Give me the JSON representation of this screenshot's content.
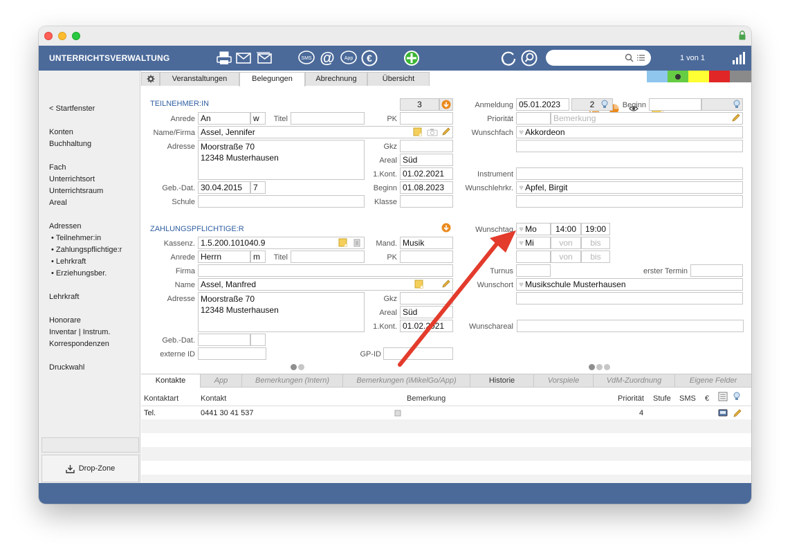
{
  "app": {
    "title": "UNTERRICHTSVERWALTUNG",
    "record_count": "1 von 1"
  },
  "search": {
    "placeholder": ""
  },
  "sidebar": {
    "back": "< Startfenster",
    "items": [
      "Konten",
      "Buchhaltung",
      "Fach",
      "Unterrichtsort",
      "Unterrichtsraum",
      "Areal",
      "Adressen"
    ],
    "adressen_sub": [
      "• Teilnehmer:in",
      "• Zahlungspflichtige:r",
      "• Lehrkraft",
      "• Erziehungsber."
    ],
    "items2": [
      "Lehrkraft",
      "Honorare",
      "Inventar | Instrum.",
      "Korrespondenzen",
      "Druckwahl"
    ],
    "dropzone": "Drop-Zone"
  },
  "tabs": [
    "Veranstaltungen",
    "Belegungen",
    "Abrechnung",
    "Übersicht"
  ],
  "active_tab": "Belegungen",
  "colors": {
    "strip": [
      "#8ec6ee",
      "#66cc44",
      "#ffff33",
      "#e02626",
      "#8a8a8a"
    ],
    "accent": "#4b6a9a",
    "orange": "#ea8a1c",
    "arrow": "#e33b2c"
  },
  "teilnehmer": {
    "section": "TEILNEHMER:IN",
    "count": "3",
    "labels": {
      "anrede": "Anrede",
      "titel": "Titel",
      "pk": "PK",
      "name": "Name/Firma",
      "adresse": "Adresse",
      "gkz": "Gkz",
      "areal": "Areal",
      "kont": "1.Kont.",
      "gebdat": "Geb.-Dat.",
      "beginn": "Beginn",
      "schule": "Schule",
      "klasse": "Klasse"
    },
    "anrede": "An",
    "anrede_code": "w",
    "titel": "",
    "pk": "",
    "name": "Assel, Jennifer",
    "adresse": "Moorstraße 70\n12348 Musterhausen",
    "gkz": "",
    "areal": "Süd",
    "kont": "01.02.2021",
    "gebdat": "30.04.2015",
    "alter": "7",
    "beginn": "01.08.2023",
    "schule": "",
    "klasse": ""
  },
  "zahler": {
    "section": "ZAHLUNGSPFLICHTIGE:R",
    "labels": {
      "kassenz": "Kassenz.",
      "mand": "Mand.",
      "anrede": "Anrede",
      "titel": "Titel",
      "pk": "PK",
      "firma": "Firma",
      "name": "Name",
      "adresse": "Adresse",
      "gkz": "Gkz",
      "areal": "Areal",
      "kont": "1.Kont.",
      "gebdat": "Geb.-Dat.",
      "externe_id": "externe ID",
      "gpid": "GP-ID"
    },
    "kassenz": "1.5.200.101040.9",
    "mand": "Musik",
    "anrede": "Herrn",
    "anrede_code": "m",
    "titel": "",
    "pk": "",
    "firma": "",
    "name": "Assel, Manfred",
    "adresse": "Moorstraße 70\n12348 Musterhausen",
    "gkz": "",
    "areal": "Süd",
    "kont": "01.02.2021",
    "gebdat": "",
    "externe_id": "",
    "gpid": ""
  },
  "anmeldung": {
    "labels": {
      "anmeldung": "Anmeldung",
      "beginn": "Beginn",
      "prioritaet": "Priorität",
      "wunschfach": "Wunschfach",
      "instrument": "Instrument",
      "wunschlehrkr": "Wunschlehrkr.",
      "wunschtag": "Wunschtag",
      "turnus": "Turnus",
      "erster_termin": "erster Termin",
      "wunschort": "Wunschort",
      "wunschareal": "Wunschareal"
    },
    "datum": "05.01.2023",
    "nummer": "2",
    "beginn": "",
    "prioritaet": "",
    "bemerkung_placeholder": "Bemerkung",
    "wunschfach": "Akkordeon",
    "wunschfach2": "",
    "instrument": "",
    "wunschlehrkr": "Apfel, Birgit",
    "wunschlehrkr2": "",
    "wunschtage": [
      {
        "tag": "Mo",
        "von": "14:00",
        "bis": "19:00"
      },
      {
        "tag": "Mi",
        "von": "von",
        "bis": "bis"
      },
      {
        "tag": "",
        "von": "von",
        "bis": "bis"
      }
    ],
    "turnus": "",
    "erster_termin": "",
    "wunschort": "Musikschule Musterhausen",
    "wunschort2": "",
    "wunschareal": ""
  },
  "bottom_tabs": [
    "Kontakte",
    "App",
    "Bemerkungen (Intern)",
    "Bemerkungen (iMikelGo/App)",
    "Historie",
    "Vorspiele",
    "VdM-Zuordnung",
    "Eigene Felder"
  ],
  "kontakte": {
    "columns": [
      "Kontaktart",
      "Kontakt",
      "Bemerkung",
      "Priorität",
      "Stufe",
      "SMS",
      "€"
    ],
    "rows": [
      {
        "art": "Tel.",
        "kontakt": "0441 30 41 537",
        "bemerkung": "",
        "prioritaet": "4"
      }
    ]
  }
}
